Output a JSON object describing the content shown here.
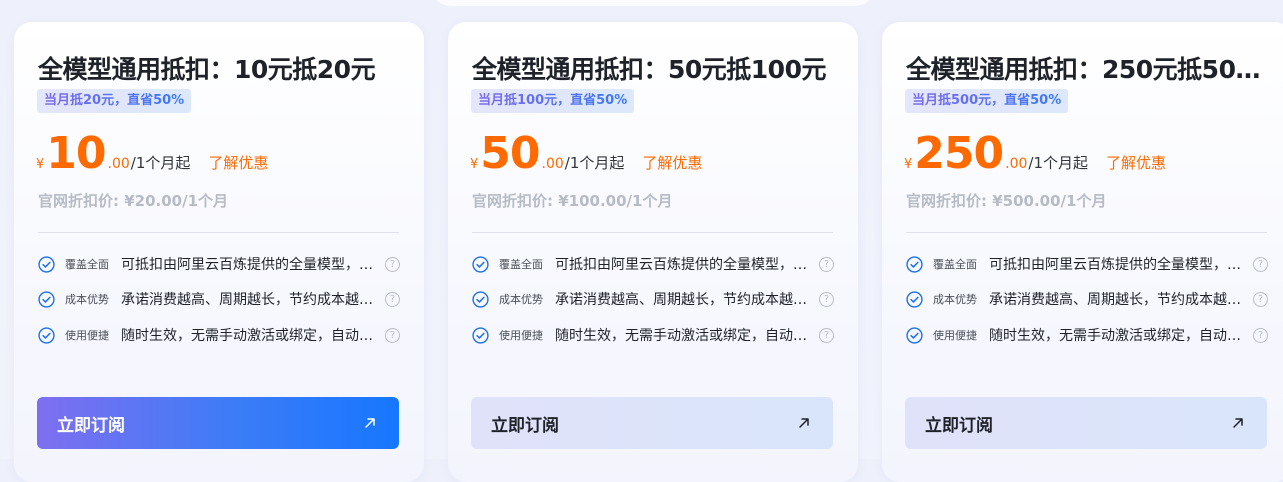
{
  "cards": [
    {
      "title": "全模型通用抵扣：10元抵20元",
      "badge": "当月抵20元，直省50%",
      "currency": "¥",
      "price_int": "10",
      "price_dec": ".00",
      "unit": "/1个月起",
      "promo_link": "了解优惠",
      "original_price": "官网折扣价: ¥20.00/1个月",
      "features": [
        {
          "label": "覆盖全面",
          "text": "可抵扣由阿里云百炼提供的全量模型，…"
        },
        {
          "label": "成本优势",
          "text": "承诺消费越高、周期越长，节约成本越…"
        },
        {
          "label": "使用便捷",
          "text": "随时生效，无需手动激活或绑定，自动…"
        }
      ],
      "button": "立即订阅",
      "button_style": "primary"
    },
    {
      "title": "全模型通用抵扣：50元抵100元",
      "badge": "当月抵100元，直省50%",
      "currency": "¥",
      "price_int": "50",
      "price_dec": ".00",
      "unit": "/1个月起",
      "promo_link": "了解优惠",
      "original_price": "官网折扣价: ¥100.00/1个月",
      "features": [
        {
          "label": "覆盖全面",
          "text": "可抵扣由阿里云百炼提供的全量模型，…"
        },
        {
          "label": "成本优势",
          "text": "承诺消费越高、周期越长，节约成本越…"
        },
        {
          "label": "使用便捷",
          "text": "随时生效，无需手动激活或绑定，自动…"
        }
      ],
      "button": "立即订阅",
      "button_style": "secondary"
    },
    {
      "title": "全模型通用抵扣：250元抵50…",
      "badge": "当月抵500元，直省50%",
      "currency": "¥",
      "price_int": "250",
      "price_dec": ".00",
      "unit": "/1个月起",
      "promo_link": "了解优惠",
      "original_price": "官网折扣价: ¥500.00/1个月",
      "features": [
        {
          "label": "覆盖全面",
          "text": "可抵扣由阿里云百炼提供的全量模型，…"
        },
        {
          "label": "成本优势",
          "text": "承诺消费越高、周期越长，节约成本越…"
        },
        {
          "label": "使用便捷",
          "text": "随时生效，无需手动激活或绑定，自动…"
        }
      ],
      "button": "立即订阅",
      "button_style": "secondary"
    }
  ],
  "icons": {
    "check": "check-circle-icon",
    "help": "question-circle-icon",
    "arrow": "arrow-up-right-icon"
  },
  "colors": {
    "price": "#ff6a00",
    "accent": "#1677ff",
    "check": "#1a6fe8"
  }
}
